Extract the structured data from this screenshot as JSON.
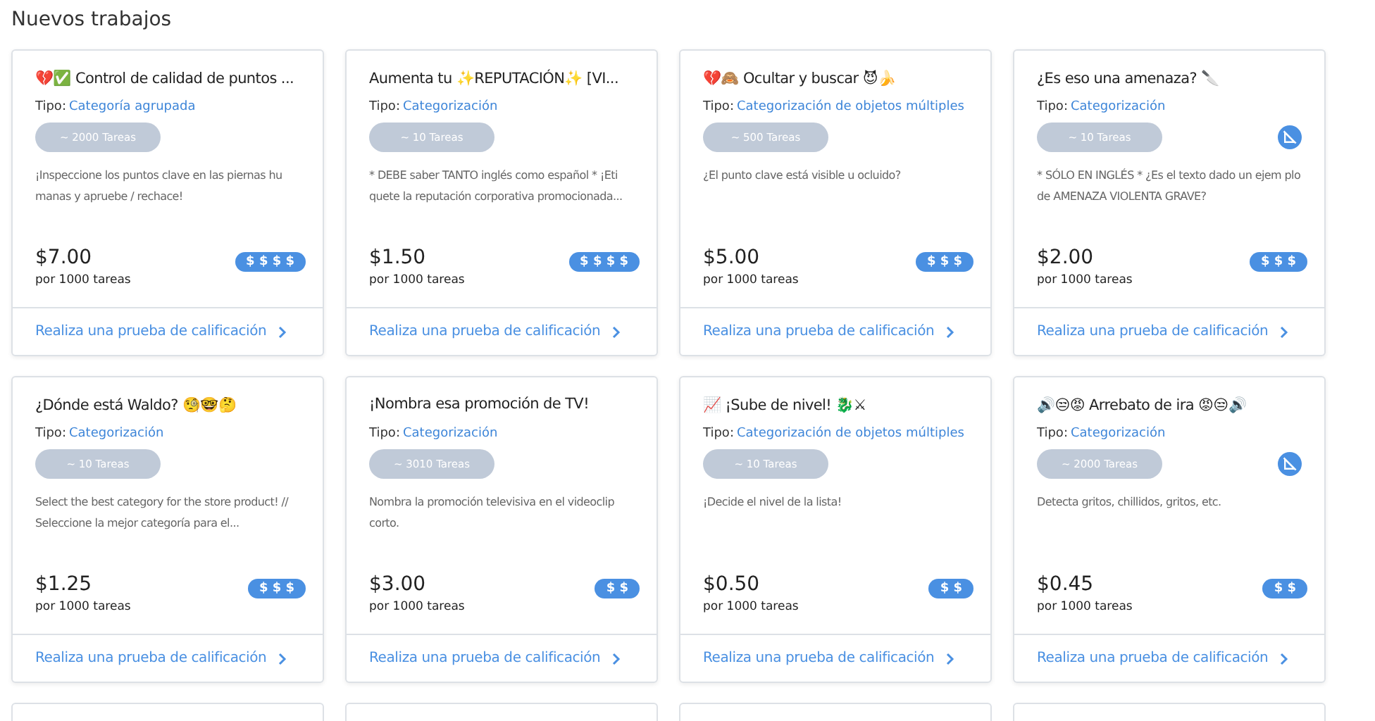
{
  "heading": "Nuevos trabajos",
  "jobs": [
    {
      "title": "💔✅ Control de calidad de puntos ...",
      "type_label": "Tipo:",
      "type": "Categoría agrupada",
      "tasks": "~ 2000 Tareas",
      "description": "¡Inspeccione los puntos clave en las piernas hu manas y apruebe / rechace!",
      "price": "$7.00",
      "per": "por 1000 tareas",
      "pay": "$ $ $ $",
      "restricted": false,
      "link": "Realiza una prueba de calificación"
    },
    {
      "title": "Aumenta tu ✨REPUTACIÓN✨ [VI...",
      "type_label": "Tipo:",
      "type": "Categorización",
      "tasks": "~ 10 Tareas",
      "description": "* DEBE saber TANTO inglés como español * ¡Eti quete la reputación corporativa promocionada...",
      "price": "$1.50",
      "per": "por 1000 tareas",
      "pay": "$ $ $ $",
      "restricted": false,
      "link": "Realiza una prueba de calificación"
    },
    {
      "title": "💔🙈 Ocultar y buscar 😈🍌",
      "type_label": "Tipo:",
      "type": "Categorización de objetos múltiples",
      "tasks": "~ 500 Tareas",
      "description": "¿El punto clave está visible u ocluido?",
      "price": "$5.00",
      "per": "por 1000 tareas",
      "pay": "$ $ $",
      "restricted": false,
      "link": "Realiza una prueba de calificación"
    },
    {
      "title": "¿Es eso una amenaza? 🔪",
      "type_label": "Tipo:",
      "type": "Categorización",
      "tasks": "~ 10 Tareas",
      "description": "* SÓLO EN INGLÉS * ¿Es el texto dado un ejem plo de AMENAZA VIOLENTA GRAVE?",
      "price": "$2.00",
      "per": "por 1000 tareas",
      "pay": "$ $ $",
      "restricted": true,
      "link": "Realiza una prueba de calificación"
    },
    {
      "title": "¿Dónde está Waldo? 🧐🤓🤔",
      "type_label": "Tipo:",
      "type": "Categorización",
      "tasks": "~ 10 Tareas",
      "description": "Select the best category for the store product! // Seleccione la mejor categoría para el...",
      "price": "$1.25",
      "per": "por 1000 tareas",
      "pay": "$ $ $",
      "restricted": false,
      "link": "Realiza una prueba de calificación"
    },
    {
      "title": "¡Nombra esa promoción de TV!",
      "type_label": "Tipo:",
      "type": "Categorización",
      "tasks": "~ 3010 Tareas",
      "description": "Nombra la promoción televisiva en el videoclip corto.",
      "price": "$3.00",
      "per": "por 1000 tareas",
      "pay": "$ $",
      "restricted": false,
      "link": "Realiza una prueba de calificación"
    },
    {
      "title": "📈 ¡Sube de nivel! 🐉⚔",
      "type_label": "Tipo:",
      "type": "Categorización de objetos múltiples",
      "tasks": "~ 10 Tareas",
      "description": "¡Decide el nivel de la lista!",
      "price": "$0.50",
      "per": "por 1000 tareas",
      "pay": "$ $",
      "restricted": false,
      "link": "Realiza una prueba de calificación"
    },
    {
      "title": "🔊😒😡 Arrebato de ira 😡😒🔊",
      "type_label": "Tipo:",
      "type": "Categorización",
      "tasks": "~ 2000 Tareas",
      "description": "Detecta gritos, chillidos, gritos, etc.",
      "price": "$0.45",
      "per": "por 1000 tareas",
      "pay": "$ $",
      "restricted": true,
      "link": "Realiza una prueba de calificación"
    }
  ]
}
